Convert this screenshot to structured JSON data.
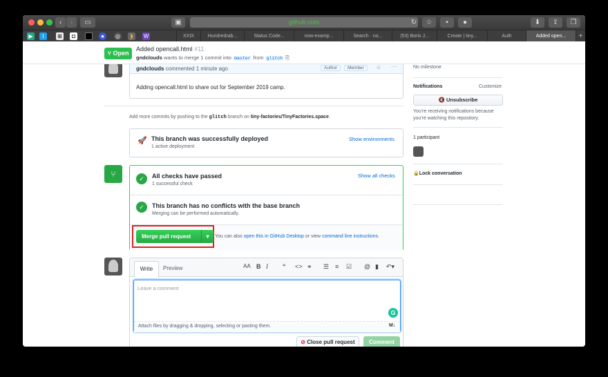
{
  "browser": {
    "url": "github.com",
    "tabs": [
      "XXIX",
      "Hundredrab...",
      "Status Code...",
      "now-examp...",
      "Search · no...",
      "(53) Boris J...",
      "Create | tiny...",
      "Auth",
      "Added open..."
    ],
    "new_tab": "+"
  },
  "header": {
    "status": "Open",
    "title": "Added opencall.html",
    "number": "#11",
    "author": "gndclouds",
    "merge_text": "wants to merge 1 commit into",
    "base_branch": "master",
    "from_text": "from",
    "head_branch": "glitch"
  },
  "comment": {
    "author": "gndclouds",
    "time": "commented 1 minute ago",
    "role1": "Author",
    "role2": "Member",
    "body": "Adding opencall.html to share out for September 2019 camp."
  },
  "push_hint": {
    "prefix": "Add more commits by pushing to the",
    "branch": "glitch",
    "middle": "branch on",
    "repo": "tiny-factories/TinyFactories.space",
    "suffix": "."
  },
  "deploy": {
    "title": "This branch was successfully deployed",
    "sub": "1 active deployment",
    "link": "Show environments"
  },
  "checks": {
    "title": "All checks have passed",
    "sub": "1 successful check",
    "link": "Show all checks",
    "conflict_title": "This branch has no conflicts with the base branch",
    "conflict_sub": "Merging can be performed automatically."
  },
  "merge": {
    "button": "Merge pull request",
    "also": "You can also",
    "desktop_link": "open this in GitHub Desktop",
    "or_view": "or view",
    "cli_link": "command line instructions",
    "period": "."
  },
  "editor": {
    "tab_write": "Write",
    "tab_preview": "Preview",
    "placeholder": "Leave a comment",
    "attach": "Attach files by dragging & dropping, selecting or pasting them.",
    "close_btn": "Close pull request",
    "comment_btn": "Comment"
  },
  "sidebar": {
    "milestone": "No milestone",
    "notifications": "Notifications",
    "customize": "Customize",
    "unsubscribe": "Unsubscribe",
    "notif_reason": "You're receiving notifications because you're watching this repository.",
    "participants": "1 participant",
    "lock": "Lock conversation"
  }
}
